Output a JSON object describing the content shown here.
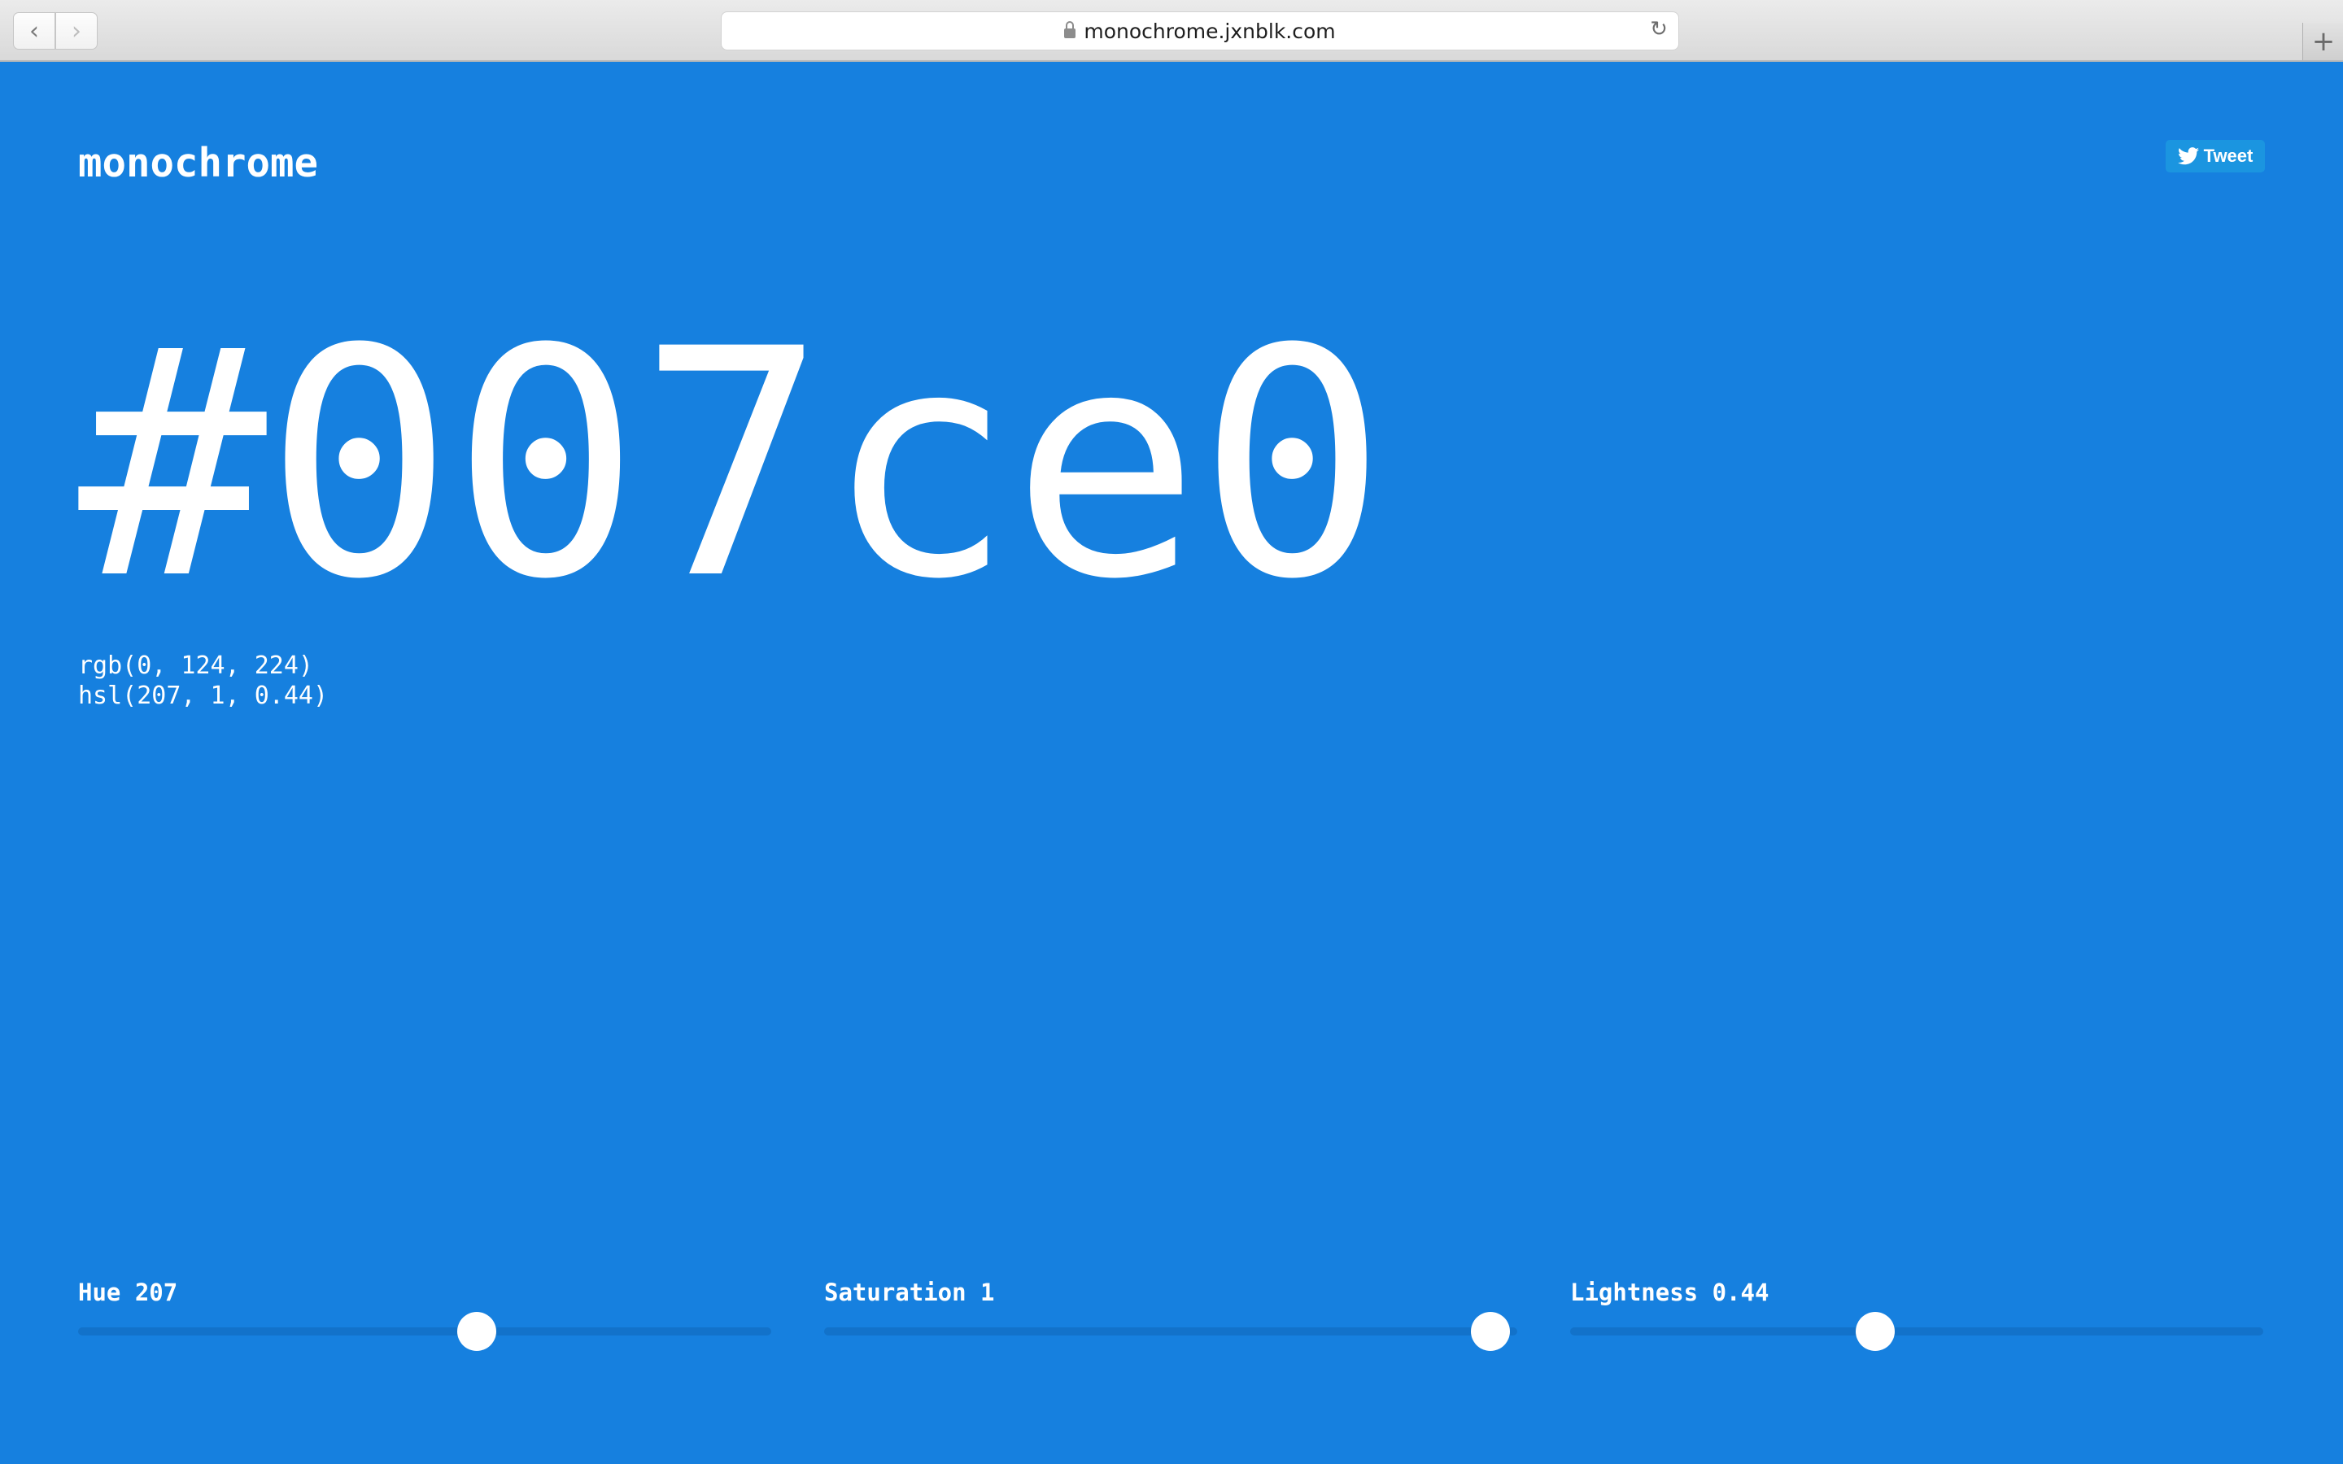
{
  "browser": {
    "url": "monochrome.jxnblk.com",
    "back_icon": "‹",
    "forward_icon": "›",
    "reload_icon": "↻",
    "newtab_icon": "+"
  },
  "page": {
    "background": "#1680df",
    "title": "monochrome",
    "tweet_label": "Tweet",
    "hex": "#007ce0",
    "rgb": "rgb(0, 124, 224)",
    "hsl": "hsl(207, 1, 0.44)"
  },
  "sliders": [
    {
      "label": "Hue 207",
      "value": 207,
      "min": 0,
      "max": 360
    },
    {
      "label": "Saturation 1",
      "value": 1,
      "min": 0,
      "max": 1.04
    },
    {
      "label": "Lightness 0.44",
      "value": 0.44,
      "min": 0,
      "max": 1
    }
  ]
}
